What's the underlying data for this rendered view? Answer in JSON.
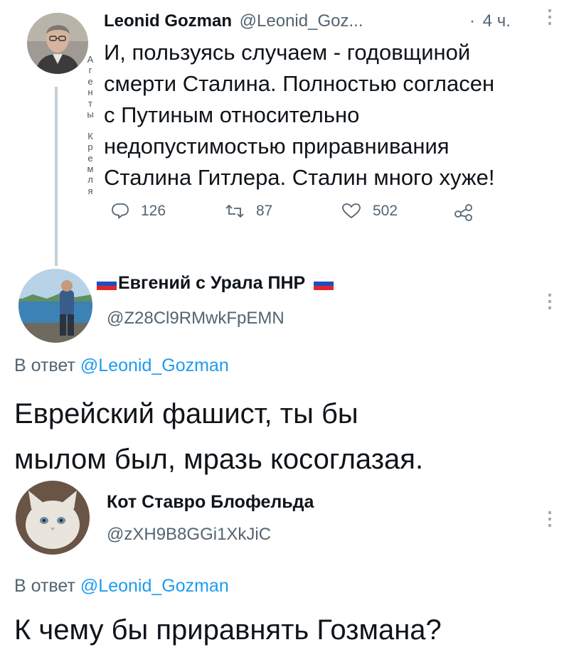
{
  "original": {
    "author_name": "Leonid Gozman",
    "handle": "@Leonid_Goz...",
    "dot": "·",
    "time": "4 ч.",
    "text_lines": [
      "И, пользуясь случаем - годовщиной",
      "смерти Сталина. Полностью согласен",
      "с Путиным относительно",
      "недопустимостью приравнивания",
      "Сталина Гитлера. Сталин много хуже!"
    ],
    "side_label": "Агенты Кремля",
    "side_letters": [
      "А",
      "г",
      "е",
      "н",
      "т",
      "ы",
      "",
      "К",
      "р",
      "е",
      "м",
      "л",
      "я"
    ],
    "replies_count": "126",
    "retweets_count": "87",
    "likes_count": "502",
    "icons": {
      "reply": "reply-icon",
      "retweet": "retweet-icon",
      "like": "heart-icon",
      "share": "share-icon",
      "more": "more-icon"
    }
  },
  "reply1": {
    "author_name": "Евгений с Урала ПНР",
    "handle": "@Z28Cl9RMwkFpEMN",
    "reply_prefix": "В ответ",
    "reply_target": "@Leonid_Gozman",
    "text_lines": [
      "Еврейский фашист, ты бы",
      "мылом был, мразь косоглазая."
    ],
    "flag_colors": [
      "#ffffff",
      "#1e4ec2",
      "#e1262a"
    ]
  },
  "reply2": {
    "author_name": "Кот Ставро Блофельда",
    "handle": "@zXH9B8GGi1XkJiC",
    "reply_prefix": "В ответ",
    "reply_target": "@Leonid_Gozman",
    "text_lines": [
      "К чему бы приравнять Гозмана?"
    ]
  },
  "colors": {
    "link": "#1d9bf0",
    "muted": "#536471",
    "thread_line": "#c4cfd6"
  }
}
